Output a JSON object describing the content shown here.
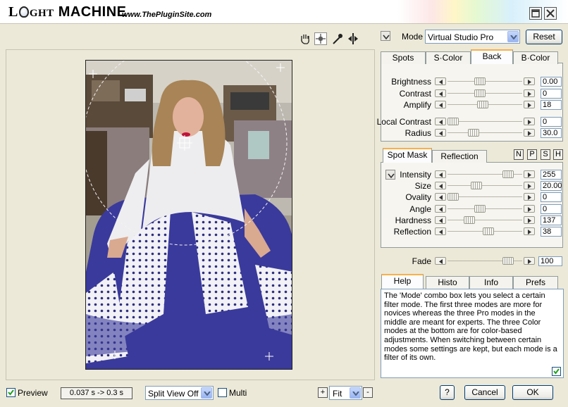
{
  "window": {
    "logo_l": "L",
    "logo_ght": "GHT",
    "logo_machine": "MACHINE",
    "url": "www.ThePluginSite.com"
  },
  "mode": {
    "label": "Mode",
    "value": "Virtual Studio Pro",
    "reset_label": "Reset"
  },
  "top_tabs": [
    "Spots",
    "S·Color",
    "Back",
    "B·Color"
  ],
  "back_sliders": [
    {
      "label": "Brightness",
      "value": "0.00",
      "pos": 0.42
    },
    {
      "label": "Contrast",
      "value": "0",
      "pos": 0.42
    },
    {
      "label": "Amplify",
      "value": "18",
      "pos": 0.47
    },
    {
      "label": "Local Contrast",
      "value": "0",
      "pos": 0.0
    },
    {
      "label": "Radius",
      "value": "30.0",
      "pos": 0.32
    }
  ],
  "spot_tabs": [
    "Spot Mask",
    "Reflection"
  ],
  "spot_buttons": [
    "N",
    "P",
    "S",
    "H"
  ],
  "spot_sliders": [
    {
      "label": "Intensity",
      "value": "255",
      "pos": 0.87
    },
    {
      "label": "Size",
      "value": "20.00",
      "pos": 0.37
    },
    {
      "label": "Ovality",
      "value": "0",
      "pos": 0.0
    },
    {
      "label": "Angle",
      "value": "0",
      "pos": 0.42
    },
    {
      "label": "Hardness",
      "value": "137",
      "pos": 0.25
    },
    {
      "label": "Reflection",
      "value": "38",
      "pos": 0.55
    }
  ],
  "fade": {
    "label": "Fade",
    "value": "100",
    "pos": 0.87
  },
  "info_tabs": [
    "Help",
    "Histo",
    "Info",
    "Prefs"
  ],
  "help_text": "The 'Mode' combo box lets you select a certain filter mode. The first three modes are more for novices whereas the three Pro modes in the middle are meant for experts. The three Color modes at the bottom are for color-based adjustments. When switching between certain modes some settings are kept, but each mode is a filter of its own.",
  "bottom": {
    "preview_label": "Preview",
    "timing": "0.037 s -> 0.3 s",
    "split_view": "Split View Off",
    "multi_label": "Multi",
    "zoom_plus": "+",
    "zoom_value": "Fit",
    "zoom_minus": "-",
    "help_btn": "?",
    "cancel_label": "Cancel",
    "ok_label": "OK"
  },
  "colors": {
    "accent": "#f8b04a",
    "skirt": "#3a3a9c",
    "button_border": "#003c74"
  }
}
